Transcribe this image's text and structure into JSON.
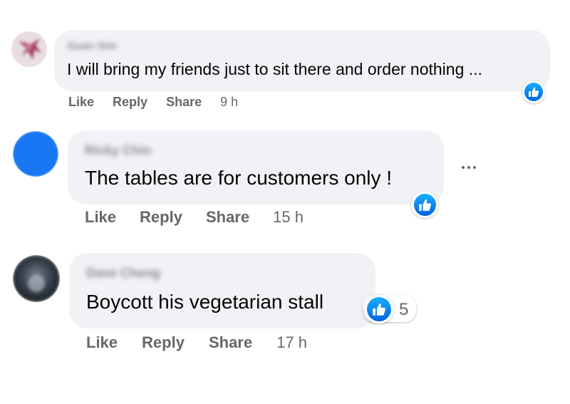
{
  "comments": [
    {
      "author": "Guan Sim",
      "text": "I will bring my friends just to sit there and order nothing ...",
      "actions": {
        "like": "Like",
        "reply": "Reply",
        "share": "Share"
      },
      "time": "9 h",
      "reaction": "like-icon"
    },
    {
      "author": "Ricky Chin",
      "text": "The tables are for customers only !",
      "actions": {
        "like": "Like",
        "reply": "Reply",
        "share": "Share"
      },
      "time": "15 h",
      "reaction": "like-icon"
    },
    {
      "author": "Dave Cheng",
      "text": "Boycott his vegetarian stall",
      "actions": {
        "like": "Like",
        "reply": "Reply",
        "share": "Share"
      },
      "time": "17 h",
      "reaction": "like-icon",
      "reaction_count": "5"
    }
  ],
  "colors": {
    "bubble": "#f0f2f5",
    "secondary_text": "#65676b",
    "like_blue": "#0866ff",
    "avatar_blue": "#1877f2"
  }
}
